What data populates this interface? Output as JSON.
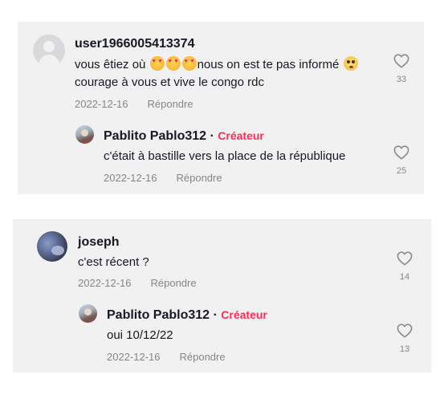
{
  "comments": [
    {
      "username": "user1966005413374",
      "text_before": "vous êtiez où ",
      "text_after": "nous on est te pas informé ",
      "text_line2": "courage à vous et vive le congo rdc",
      "emojis": [
        "smiling-face-with-hearts-icon",
        "smiling-face-with-hearts-icon",
        "smiling-face-with-hearts-icon",
        "flushed-face-icon"
      ],
      "date": "2022-12-16",
      "reply_label": "Répondre",
      "likes": "33",
      "reply": {
        "username": "Pablito Pablo312",
        "separator": "·",
        "badge": "Créateur",
        "text": "c'était à bastille vers la place de la république",
        "date": "2022-12-16",
        "reply_label": "Répondre",
        "likes": "25"
      }
    },
    {
      "username": "joseph",
      "text": "c'est récent ?",
      "date": "2022-12-16",
      "reply_label": "Répondre",
      "likes": "14",
      "reply": {
        "username": "Pablito Pablo312",
        "separator": "·",
        "badge": "Créateur",
        "text": "oui 10/12/22",
        "date": "2022-12-16",
        "reply_label": "Répondre",
        "likes": "13"
      }
    }
  ],
  "colors": {
    "card_background": "#f1f1f2",
    "creator_badge": "#fe2c55",
    "muted_text": "#8a8b91",
    "heart_outline": "#8a8b91"
  }
}
